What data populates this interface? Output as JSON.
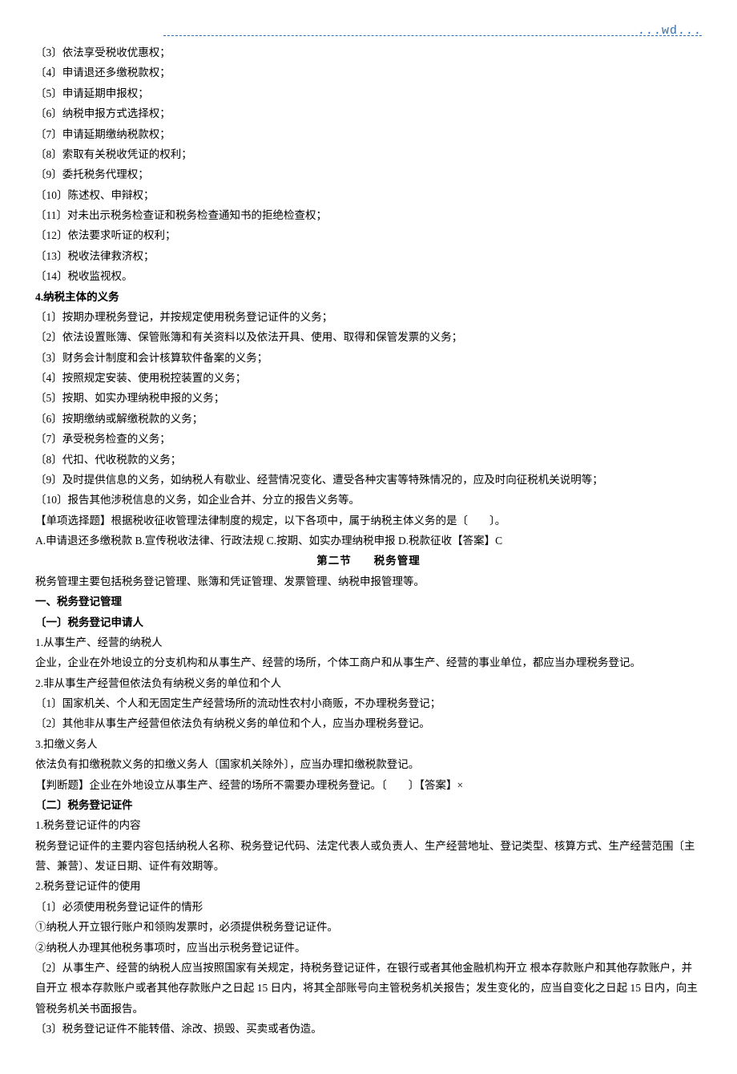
{
  "header": {
    "wd": "...wd..."
  },
  "lines": {
    "r3": "〔3〕依法享受税收优惠权；",
    "r4": "〔4〕申请退还多缴税款权；",
    "r5": "〔5〕申请延期申报权；",
    "r6": "〔6〕纳税申报方式选择权；",
    "r7": "〔7〕申请延期缴纳税款权；",
    "r8": "〔8〕索取有关税收凭证的权利；",
    "r9": "〔9〕委托税务代理权；",
    "r10": "〔10〕陈述权、申辩权；",
    "r11": "〔11〕对未出示税务检查证和税务检查通知书的拒绝检查权；",
    "r12": "〔12〕依法要求听证的权利；",
    "r13": "〔13〕税收法律救济权；",
    "r14": "〔14〕税收监视权。",
    "h4": "4.纳税主体的义务",
    "d1": "〔1〕按期办理税务登记，并按规定使用税务登记证件的义务；",
    "d2": "〔2〕依法设置账簿、保管账簿和有关资料以及依法开具、使用、取得和保管发票的义务；",
    "d3": "〔3〕财务会计制度和会计核算软件备案的义务；",
    "d4": "〔4〕按照规定安装、使用税控装置的义务；",
    "d5": "〔5〕按期、如实办理纳税申报的义务；",
    "d6": "〔6〕按期缴纳或解缴税款的义务；",
    "d7": "〔7〕承受税务检查的义务；",
    "d8": "〔8〕代扣、代收税款的义务；",
    "d9": "〔9〕及时提供信息的义务，如纳税人有歇业、经营情况变化、遭受各种灾害等特殊情况的，应及时向征税机关说明等；",
    "d10": "〔10〕报告其他涉税信息的义务，如企业合并、分立的报告义务等。",
    "q1": "【单项选择题】根据税收征收管理法律制度的规定，以下各项中，属于纳税主体义务的是〔　　〕。",
    "q2": "A.申请退还多缴税款 B.宣传税收法律、行政法规 C.按期、如实办理纳税申报 D.税款征收【答案】C",
    "sec2a": "第二节",
    "sec2b": "税务管理",
    "t1": "税务管理主要包括税务登记管理、账簿和凭证管理、发票管理、纳税申报管理等。",
    "h_a": "一、税务登记管理",
    "h_a1": "〔一〕税务登记申请人",
    "a1_1": "1.从事生产、经营的纳税人",
    "a1_2": "企业，企业在外地设立的分支机构和从事生产、经营的场所，个体工商户和从事生产、经营的事业单位，都应当办理税务登记。",
    "a2_1": "2.非从事生产经营但依法负有纳税义务的单位和个人",
    "a2_2": "〔1〕国家机关、个人和无固定生产经营场所的流动性农村小商贩，不办理税务登记；",
    "a2_3": "〔2〕其他非从事生产经营但依法负有纳税义务的单位和个人，应当办理税务登记。",
    "a3_1": "3.扣缴义务人",
    "a3_2": "依法负有扣缴税款义务的扣缴义务人〔国家机关除外〕，应当办理扣缴税款登记。",
    "j1": "【判断题】企业在外地设立从事生产、经营的场所不需要办理税务登记。〔　　〕【答案】×",
    "h_b": "〔二〕税务登记证件",
    "b1_1": "1.税务登记证件的内容",
    "b1_2": "税务登记证件的主要内容包括纳税人名称、税务登记代码、法定代表人或负责人、生产经营地址、登记类型、核算方式、生产经营范围〔主营、兼营〕、发证日期、证件有效期等。",
    "b2_1": "2.税务登记证件的使用",
    "b2_2": "〔1〕必须使用税务登记证件的情形",
    "b2_3": "①纳税人开立银行账户和领购发票时，必须提供税务登记证件。",
    "b2_4": "②纳税人办理其他税务事项时，应当出示税务登记证件。",
    "b2_5": "〔2〕从事生产、经营的纳税人应当按照国家有关规定，持税务登记证件，在银行或者其他金融机构开立 根本存款账户和其他存款账户，并自开立 根本存款账户或者其他存款账户之日起 15 日内，将其全部账号向主管税务机关报告；发生变化的，应当自变化之日起 15 日内，向主管税务机关书面报告。",
    "b2_6": "〔3〕税务登记证件不能转借、涂改、损毁、买卖或者伪造。"
  }
}
